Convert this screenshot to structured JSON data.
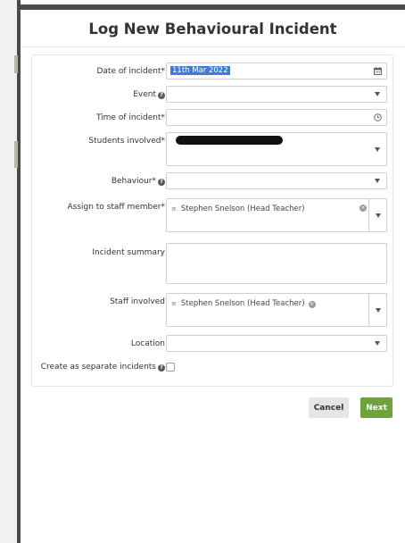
{
  "modal": {
    "title": "Log New Behavioural Incident"
  },
  "form": {
    "date": {
      "label": "Date of incident*",
      "value": "11th Mar 2022",
      "icon": "calendar-icon"
    },
    "event": {
      "label": "Event",
      "value": "",
      "icon": "chevron-down-icon"
    },
    "time": {
      "label": "Time of incident*",
      "value": "",
      "icon": "clock-icon"
    },
    "students": {
      "label": "Students involved*",
      "value": ""
    },
    "behaviour": {
      "label": "Behaviour*",
      "value": ""
    },
    "assign": {
      "label": "Assign to staff member*",
      "tag": "Stephen Snelson (Head Teacher)"
    },
    "summary": {
      "label": "Incident summary",
      "value": ""
    },
    "staff": {
      "label": "Staff involved",
      "tag": "Stephen Snelson (Head Teacher)"
    },
    "location": {
      "label": "Location",
      "value": ""
    },
    "separate": {
      "label": "Create as separate incidents",
      "checked": false
    }
  },
  "buttons": {
    "cancel": "Cancel",
    "next": "Next"
  },
  "colors": {
    "accent_green": "#6ea23a",
    "selection_blue": "#3b7ddd"
  }
}
